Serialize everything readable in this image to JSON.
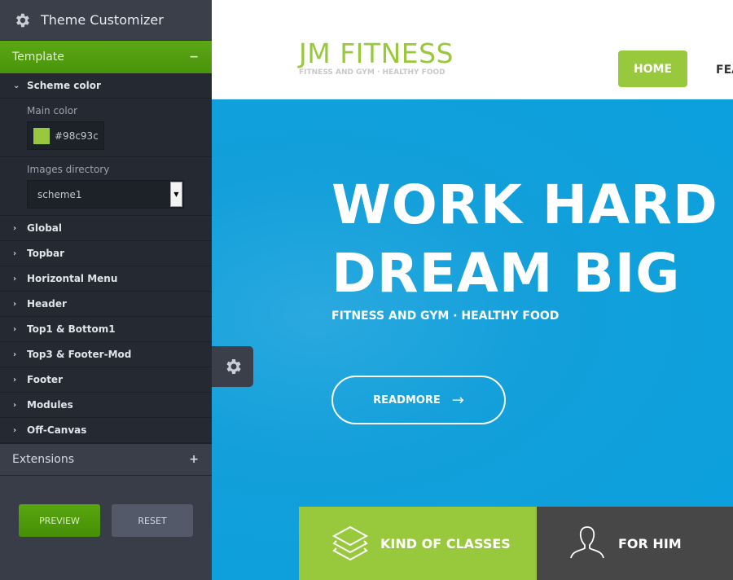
{
  "customizer": {
    "title": "Theme Customizer",
    "template_label": "Template",
    "template_toggle": "−",
    "scheme_color": "Scheme color",
    "main_color_label": "Main color",
    "main_color_value": "#98c93c",
    "images_dir_label": "Images directory",
    "images_dir_value": "scheme1",
    "items": [
      "Global",
      "Topbar",
      "Horizontal Menu",
      "Header",
      "Top1 & Bottom1",
      "Top3 & Footer-Mod",
      "Footer",
      "Modules",
      "Off-Canvas"
    ],
    "extensions_label": "Extensions",
    "extensions_toggle": "+",
    "preview": "PREVIEW",
    "reset": "RESET"
  },
  "site": {
    "logo": "JM FITNESS",
    "tagline": "FITNESS AND GYM · HEALTHY FOOD",
    "nav": [
      "HOME",
      "FEA"
    ],
    "hero_line1": "WORK HARD",
    "hero_line2": "DREAM BIG",
    "hero_sub": "FITNESS AND GYM · HEALTHY FOOD",
    "readmore": "READMORE",
    "box1": "KIND OF CLASSES",
    "box2": "FOR HIM"
  },
  "colors": {
    "accent": "#98c93c",
    "hero": "#0ea3dd",
    "sidebar": "#393d48",
    "green_button": "#4f9a0c"
  }
}
